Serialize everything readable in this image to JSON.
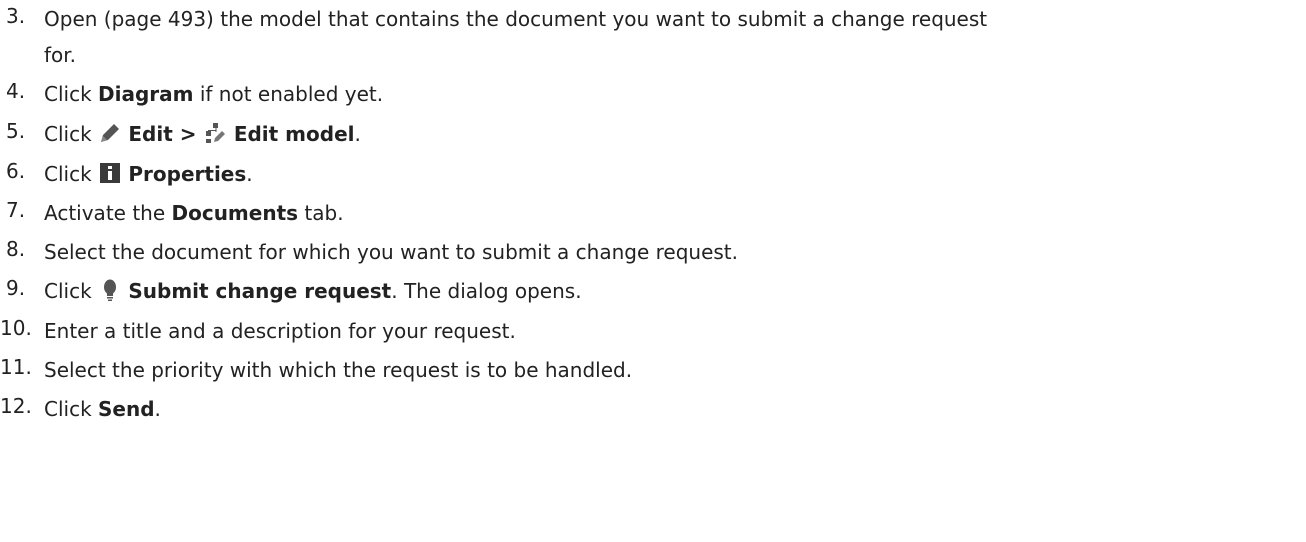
{
  "steps": [
    {
      "number": "3.",
      "line1_a": "Open (page 493) the model that contains the document you want to submit a change request",
      "line2_a": "for."
    },
    {
      "number": "4.",
      "a": "Click ",
      "b": "Diagram",
      "c": " if not enabled yet."
    },
    {
      "number": "5.",
      "a": "Click ",
      "icon1": "pencil-icon",
      "b": "Edit > ",
      "icon2": "edit-model-icon",
      "c": "Edit model",
      "d": "."
    },
    {
      "number": "6.",
      "a": "Click ",
      "icon1": "info-icon",
      "b": "Properties",
      "c": "."
    },
    {
      "number": "7.",
      "a": "Activate the ",
      "b": "Documents",
      "c": " tab."
    },
    {
      "number": "8.",
      "a": "Select the document for which you want to submit a change request."
    },
    {
      "number": "9.",
      "a": "Click ",
      "icon1": "lightbulb-icon",
      "b": "Submit change request",
      "c": ". The dialog opens."
    },
    {
      "number": "10.",
      "a": "Enter a title and a description for your request."
    },
    {
      "number": "11.",
      "a": "Select the priority with which the request is to be handled."
    },
    {
      "number": "12.",
      "a": "Click ",
      "b": "Send",
      "c": "."
    }
  ],
  "colors": {
    "text": "#222222",
    "icon": "#555555"
  }
}
